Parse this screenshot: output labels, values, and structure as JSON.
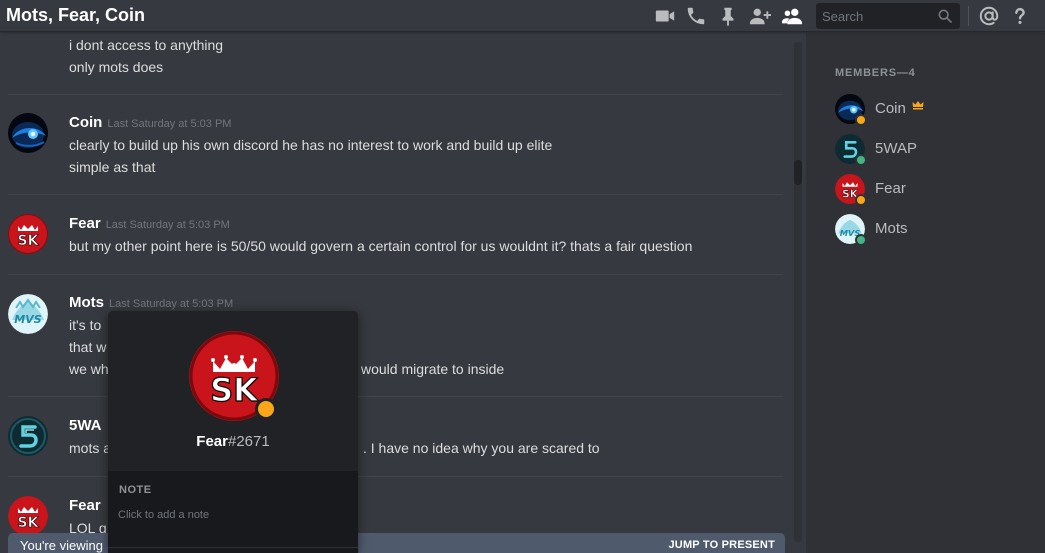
{
  "header": {
    "title": "Mots, Fear, Coin",
    "search_placeholder": "Search",
    "icons": [
      "video-camera-icon",
      "phone-icon",
      "pin-icon",
      "add-friend-icon",
      "members-icon",
      "search-icon",
      "mention-icon",
      "help-icon"
    ]
  },
  "messages": [
    {
      "author": "",
      "timestamp": "",
      "lines": [
        "i dont access to anything",
        "only mots does"
      ]
    },
    {
      "author": "Coin",
      "timestamp": "Last Saturday at 5:03 PM",
      "lines": [
        "clearly to build up his own discord he has no interest to work and build up elite",
        "simple as that"
      ]
    },
    {
      "author": "Fear",
      "timestamp": "Last Saturday at 5:03 PM",
      "lines": [
        "but my other point here is 50/50 would govern a certain control for us wouldnt it? thats a fair question"
      ]
    },
    {
      "author": "Mots",
      "timestamp": "Last Saturday at 5:03 PM",
      "lines": [
        "it's to",
        "that w",
        "we wh",
        "would migrate to inside"
      ]
    },
    {
      "author": "5WA",
      "timestamp": "",
      "lines": [
        "mots a",
        ". I have no idea why you are scared to"
      ]
    },
    {
      "author": "Fear",
      "timestamp": "",
      "lines": [
        "LOL g"
      ]
    }
  ],
  "jump_bar": {
    "left_text": "You're viewing",
    "right_text": "JUMP TO PRESENT"
  },
  "members": {
    "header": "MEMBERS—4",
    "list": [
      {
        "name": "Coin",
        "status": "idle",
        "status_color": "#faa61a",
        "owner": true
      },
      {
        "name": "5WAP",
        "status": "online",
        "status_color": "#43b581",
        "owner": false
      },
      {
        "name": "Fear",
        "status": "idle",
        "status_color": "#faa61a",
        "owner": false
      },
      {
        "name": "Mots",
        "status": "online",
        "status_color": "#43b581",
        "owner": false
      }
    ]
  },
  "popout": {
    "username": "Fear",
    "discriminator": "#2671",
    "status": "idle",
    "note_label": "NOTE",
    "note_placeholder": "Click to add a note"
  },
  "colors": {
    "background": "#36393f",
    "sidebar": "#2f3136",
    "popout": "#18191c",
    "idle": "#faa61a",
    "online": "#43b581",
    "crown": "#faa61a"
  }
}
